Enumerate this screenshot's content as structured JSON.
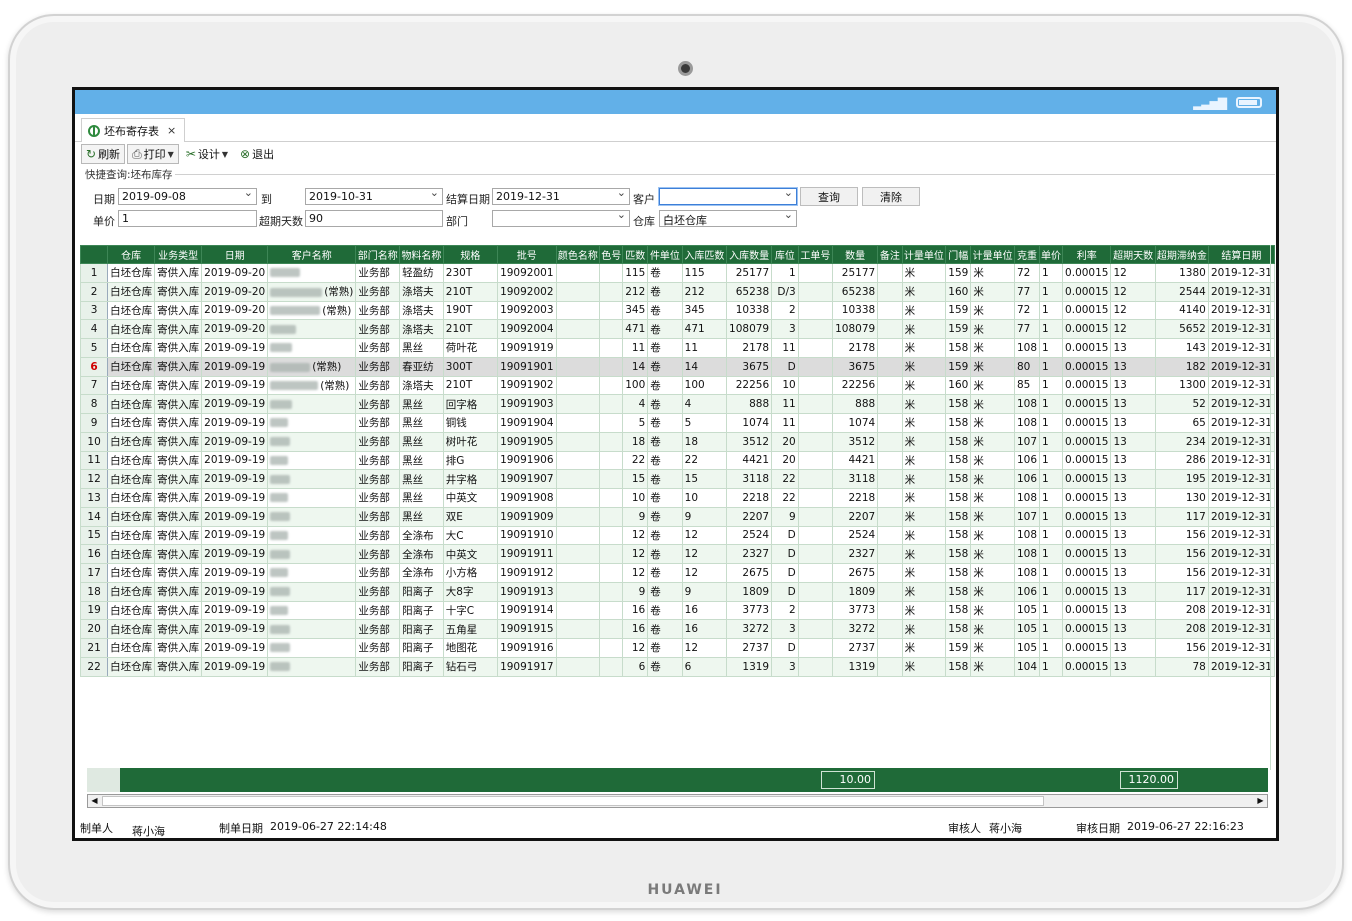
{
  "device": {
    "brand": "HUAWEI"
  },
  "tab": {
    "title": "坯布寄存表",
    "close": "×"
  },
  "toolbar": {
    "refresh": "刷新",
    "print": "打印",
    "design": "设计",
    "exit": "退出"
  },
  "query": {
    "title": "快捷查询:坯布库存",
    "date_label": "日期",
    "date_from": "2019-09-08",
    "to_label": "到",
    "date_to": "2019-10-31",
    "settle_label": "结算日期",
    "settle_date": "2019-12-31",
    "customer_label": "客户",
    "customer": "",
    "price_label": "单价",
    "price": "1",
    "overdue_label": "超期天数",
    "overdue": "90",
    "dept_label": "部门",
    "dept": "",
    "warehouse_label": "仓库",
    "warehouse": "白坯仓库",
    "search_button": "查询",
    "clear_button": "清除"
  },
  "columns": [
    "仓库",
    "业务类型",
    "日期",
    "客户名称",
    "部门名称",
    "物料名称",
    "规格",
    "批号",
    "颜色名称",
    "色号",
    "匹数",
    "件单位",
    "入库匹数",
    "入库数量",
    "库位",
    "工单号",
    "数量",
    "备注",
    "计量单位",
    "门幅",
    "计量单位",
    "克重",
    "单价",
    "利率",
    "超期天数",
    "超期滞纳金",
    "结算日期"
  ],
  "rows": [
    [
      "1",
      "白坯仓库",
      "寄供入库",
      "2019-09-20",
      "",
      "业务部",
      "轻盈纺",
      "230T",
      "19092001",
      "",
      "",
      "115",
      "卷",
      "115",
      "25177",
      "1",
      "",
      "25177",
      "",
      "米",
      "159",
      "米",
      "72",
      "1",
      "0.00015",
      "12",
      "1380",
      "2019-12-31"
    ],
    [
      "2",
      "白坯仓库",
      "寄供入库",
      "2019-09-20",
      "(常熟)",
      "业务部",
      "涤塔夫",
      "210T",
      "19092002",
      "",
      "",
      "212",
      "卷",
      "212",
      "65238",
      "D/3",
      "",
      "65238",
      "",
      "米",
      "160",
      "米",
      "77",
      "1",
      "0.00015",
      "12",
      "2544",
      "2019-12-31"
    ],
    [
      "3",
      "白坯仓库",
      "寄供入库",
      "2019-09-20",
      "(常熟)",
      "业务部",
      "涤塔夫",
      "190T",
      "19092003",
      "",
      "",
      "345",
      "卷",
      "345",
      "10338",
      "2",
      "",
      "10338",
      "",
      "米",
      "159",
      "米",
      "72",
      "1",
      "0.00015",
      "12",
      "4140",
      "2019-12-31"
    ],
    [
      "4",
      "白坯仓库",
      "寄供入库",
      "2019-09-20",
      "",
      "业务部",
      "涤塔夫",
      "210T",
      "19092004",
      "",
      "",
      "471",
      "卷",
      "471",
      "108079",
      "3",
      "",
      "108079",
      "",
      "米",
      "159",
      "米",
      "77",
      "1",
      "0.00015",
      "12",
      "5652",
      "2019-12-31"
    ],
    [
      "5",
      "白坯仓库",
      "寄供入库",
      "2019-09-19",
      "",
      "业务部",
      "黑丝",
      "荷叶花",
      "19091919",
      "",
      "",
      "11",
      "卷",
      "11",
      "2178",
      "11",
      "",
      "2178",
      "",
      "米",
      "158",
      "米",
      "108",
      "1",
      "0.00015",
      "13",
      "143",
      "2019-12-31"
    ],
    [
      "6",
      "白坯仓库",
      "寄供入库",
      "2019-09-19",
      "(常熟)",
      "业务部",
      "春亚纺",
      "300T",
      "19091901",
      "",
      "",
      "14",
      "卷",
      "14",
      "3675",
      "D",
      "",
      "3675",
      "",
      "米",
      "159",
      "米",
      "80",
      "1",
      "0.00015",
      "13",
      "182",
      "2019-12-31"
    ],
    [
      "7",
      "白坯仓库",
      "寄供入库",
      "2019-09-19",
      "(常熟)",
      "业务部",
      "涤塔夫",
      "210T",
      "19091902",
      "",
      "",
      "100",
      "卷",
      "100",
      "22256",
      "10",
      "",
      "22256",
      "",
      "米",
      "160",
      "米",
      "85",
      "1",
      "0.00015",
      "13",
      "1300",
      "2019-12-31"
    ],
    [
      "8",
      "白坯仓库",
      "寄供入库",
      "2019-09-19",
      "",
      "业务部",
      "黑丝",
      "回字格",
      "19091903",
      "",
      "",
      "4",
      "卷",
      "4",
      "888",
      "11",
      "",
      "888",
      "",
      "米",
      "158",
      "米",
      "108",
      "1",
      "0.00015",
      "13",
      "52",
      "2019-12-31"
    ],
    [
      "9",
      "白坯仓库",
      "寄供入库",
      "2019-09-19",
      "",
      "业务部",
      "黑丝",
      "铜钱",
      "19091904",
      "",
      "",
      "5",
      "卷",
      "5",
      "1074",
      "11",
      "",
      "1074",
      "",
      "米",
      "158",
      "米",
      "108",
      "1",
      "0.00015",
      "13",
      "65",
      "2019-12-31"
    ],
    [
      "10",
      "白坯仓库",
      "寄供入库",
      "2019-09-19",
      "",
      "业务部",
      "黑丝",
      "树叶花",
      "19091905",
      "",
      "",
      "18",
      "卷",
      "18",
      "3512",
      "20",
      "",
      "3512",
      "",
      "米",
      "158",
      "米",
      "107",
      "1",
      "0.00015",
      "13",
      "234",
      "2019-12-31"
    ],
    [
      "11",
      "白坯仓库",
      "寄供入库",
      "2019-09-19",
      "",
      "业务部",
      "黑丝",
      "排G",
      "19091906",
      "",
      "",
      "22",
      "卷",
      "22",
      "4421",
      "20",
      "",
      "4421",
      "",
      "米",
      "158",
      "米",
      "106",
      "1",
      "0.00015",
      "13",
      "286",
      "2019-12-31"
    ],
    [
      "12",
      "白坯仓库",
      "寄供入库",
      "2019-09-19",
      "",
      "业务部",
      "黑丝",
      "井字格",
      "19091907",
      "",
      "",
      "15",
      "卷",
      "15",
      "3118",
      "22",
      "",
      "3118",
      "",
      "米",
      "158",
      "米",
      "106",
      "1",
      "0.00015",
      "13",
      "195",
      "2019-12-31"
    ],
    [
      "13",
      "白坯仓库",
      "寄供入库",
      "2019-09-19",
      "",
      "业务部",
      "黑丝",
      "中英文",
      "19091908",
      "",
      "",
      "10",
      "卷",
      "10",
      "2218",
      "22",
      "",
      "2218",
      "",
      "米",
      "158",
      "米",
      "108",
      "1",
      "0.00015",
      "13",
      "130",
      "2019-12-31"
    ],
    [
      "14",
      "白坯仓库",
      "寄供入库",
      "2019-09-19",
      "",
      "业务部",
      "黑丝",
      "双E",
      "19091909",
      "",
      "",
      "9",
      "卷",
      "9",
      "2207",
      "9",
      "",
      "2207",
      "",
      "米",
      "158",
      "米",
      "107",
      "1",
      "0.00015",
      "13",
      "117",
      "2019-12-31"
    ],
    [
      "15",
      "白坯仓库",
      "寄供入库",
      "2019-09-19",
      "",
      "业务部",
      "全涤布",
      "大C",
      "19091910",
      "",
      "",
      "12",
      "卷",
      "12",
      "2524",
      "D",
      "",
      "2524",
      "",
      "米",
      "158",
      "米",
      "108",
      "1",
      "0.00015",
      "13",
      "156",
      "2019-12-31"
    ],
    [
      "16",
      "白坯仓库",
      "寄供入库",
      "2019-09-19",
      "",
      "业务部",
      "全涤布",
      "中英文",
      "19091911",
      "",
      "",
      "12",
      "卷",
      "12",
      "2327",
      "D",
      "",
      "2327",
      "",
      "米",
      "158",
      "米",
      "108",
      "1",
      "0.00015",
      "13",
      "156",
      "2019-12-31"
    ],
    [
      "17",
      "白坯仓库",
      "寄供入库",
      "2019-09-19",
      "",
      "业务部",
      "全涤布",
      "小方格",
      "19091912",
      "",
      "",
      "12",
      "卷",
      "12",
      "2675",
      "D",
      "",
      "2675",
      "",
      "米",
      "158",
      "米",
      "108",
      "1",
      "0.00015",
      "13",
      "156",
      "2019-12-31"
    ],
    [
      "18",
      "白坯仓库",
      "寄供入库",
      "2019-09-19",
      "",
      "业务部",
      "阳离子",
      "大8字",
      "19091913",
      "",
      "",
      "9",
      "卷",
      "9",
      "1809",
      "D",
      "",
      "1809",
      "",
      "米",
      "158",
      "米",
      "106",
      "1",
      "0.00015",
      "13",
      "117",
      "2019-12-31"
    ],
    [
      "19",
      "白坯仓库",
      "寄供入库",
      "2019-09-19",
      "",
      "业务部",
      "阳离子",
      "十字C",
      "19091914",
      "",
      "",
      "16",
      "卷",
      "16",
      "3773",
      "2",
      "",
      "3773",
      "",
      "米",
      "158",
      "米",
      "105",
      "1",
      "0.00015",
      "13",
      "208",
      "2019-12-31"
    ],
    [
      "20",
      "白坯仓库",
      "寄供入库",
      "2019-09-19",
      "",
      "业务部",
      "阳离子",
      "五角星",
      "19091915",
      "",
      "",
      "16",
      "卷",
      "16",
      "3272",
      "3",
      "",
      "3272",
      "",
      "米",
      "158",
      "米",
      "105",
      "1",
      "0.00015",
      "13",
      "208",
      "2019-12-31"
    ],
    [
      "21",
      "白坯仓库",
      "寄供入库",
      "2019-09-19",
      "",
      "业务部",
      "阳离子",
      "地图花",
      "19091916",
      "",
      "",
      "12",
      "卷",
      "12",
      "2737",
      "D",
      "",
      "2737",
      "",
      "米",
      "159",
      "米",
      "105",
      "1",
      "0.00015",
      "13",
      "156",
      "2019-12-31"
    ],
    [
      "22",
      "白坯仓库",
      "寄供入库",
      "2019-09-19",
      "",
      "业务部",
      "阳离子",
      "钻石弓",
      "19091917",
      "",
      "",
      "6",
      "卷",
      "6",
      "1319",
      "3",
      "",
      "1319",
      "",
      "米",
      "158",
      "米",
      "104",
      "1",
      "0.00015",
      "13",
      "78",
      "2019-12-31"
    ]
  ],
  "current_row": 6,
  "summary": {
    "quantity_total": "10.00",
    "fee_total": "1120.00"
  },
  "footer": {
    "maker_label": "制单人",
    "maker": "蒋小海",
    "make_date_label": "制单日期",
    "make_date": "2019-06-27 22:14:48",
    "auditor_label": "审核人",
    "auditor": "蒋小海",
    "audit_date_label": "审核日期",
    "audit_date": "2019-06-27 22:16:23"
  },
  "colors": {
    "header_green": "#1f6a38",
    "status_blue": "#62b0e8",
    "current_row_mark": "#d00000"
  }
}
